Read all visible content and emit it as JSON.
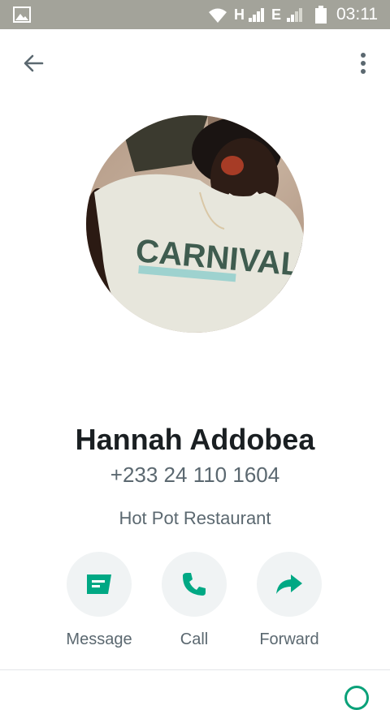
{
  "status_bar": {
    "network_1": "H",
    "network_2": "E",
    "time": "03:11"
  },
  "contact": {
    "name": "Hannah Addobea",
    "phone": "+233 24 110 1604",
    "company": "Hot Pot Restaurant",
    "avatar_shirt_text": "CARNIVAL"
  },
  "actions": [
    {
      "label": "Message",
      "icon": "message-icon"
    },
    {
      "label": "Call",
      "icon": "phone-icon"
    },
    {
      "label": "Forward",
      "icon": "forward-icon"
    }
  ],
  "colors": {
    "accent": "#00a884",
    "status_bar": "#a3a39a",
    "text_primary": "#1a1f22",
    "text_secondary": "#5b6870",
    "button_bg": "#f0f3f4"
  }
}
